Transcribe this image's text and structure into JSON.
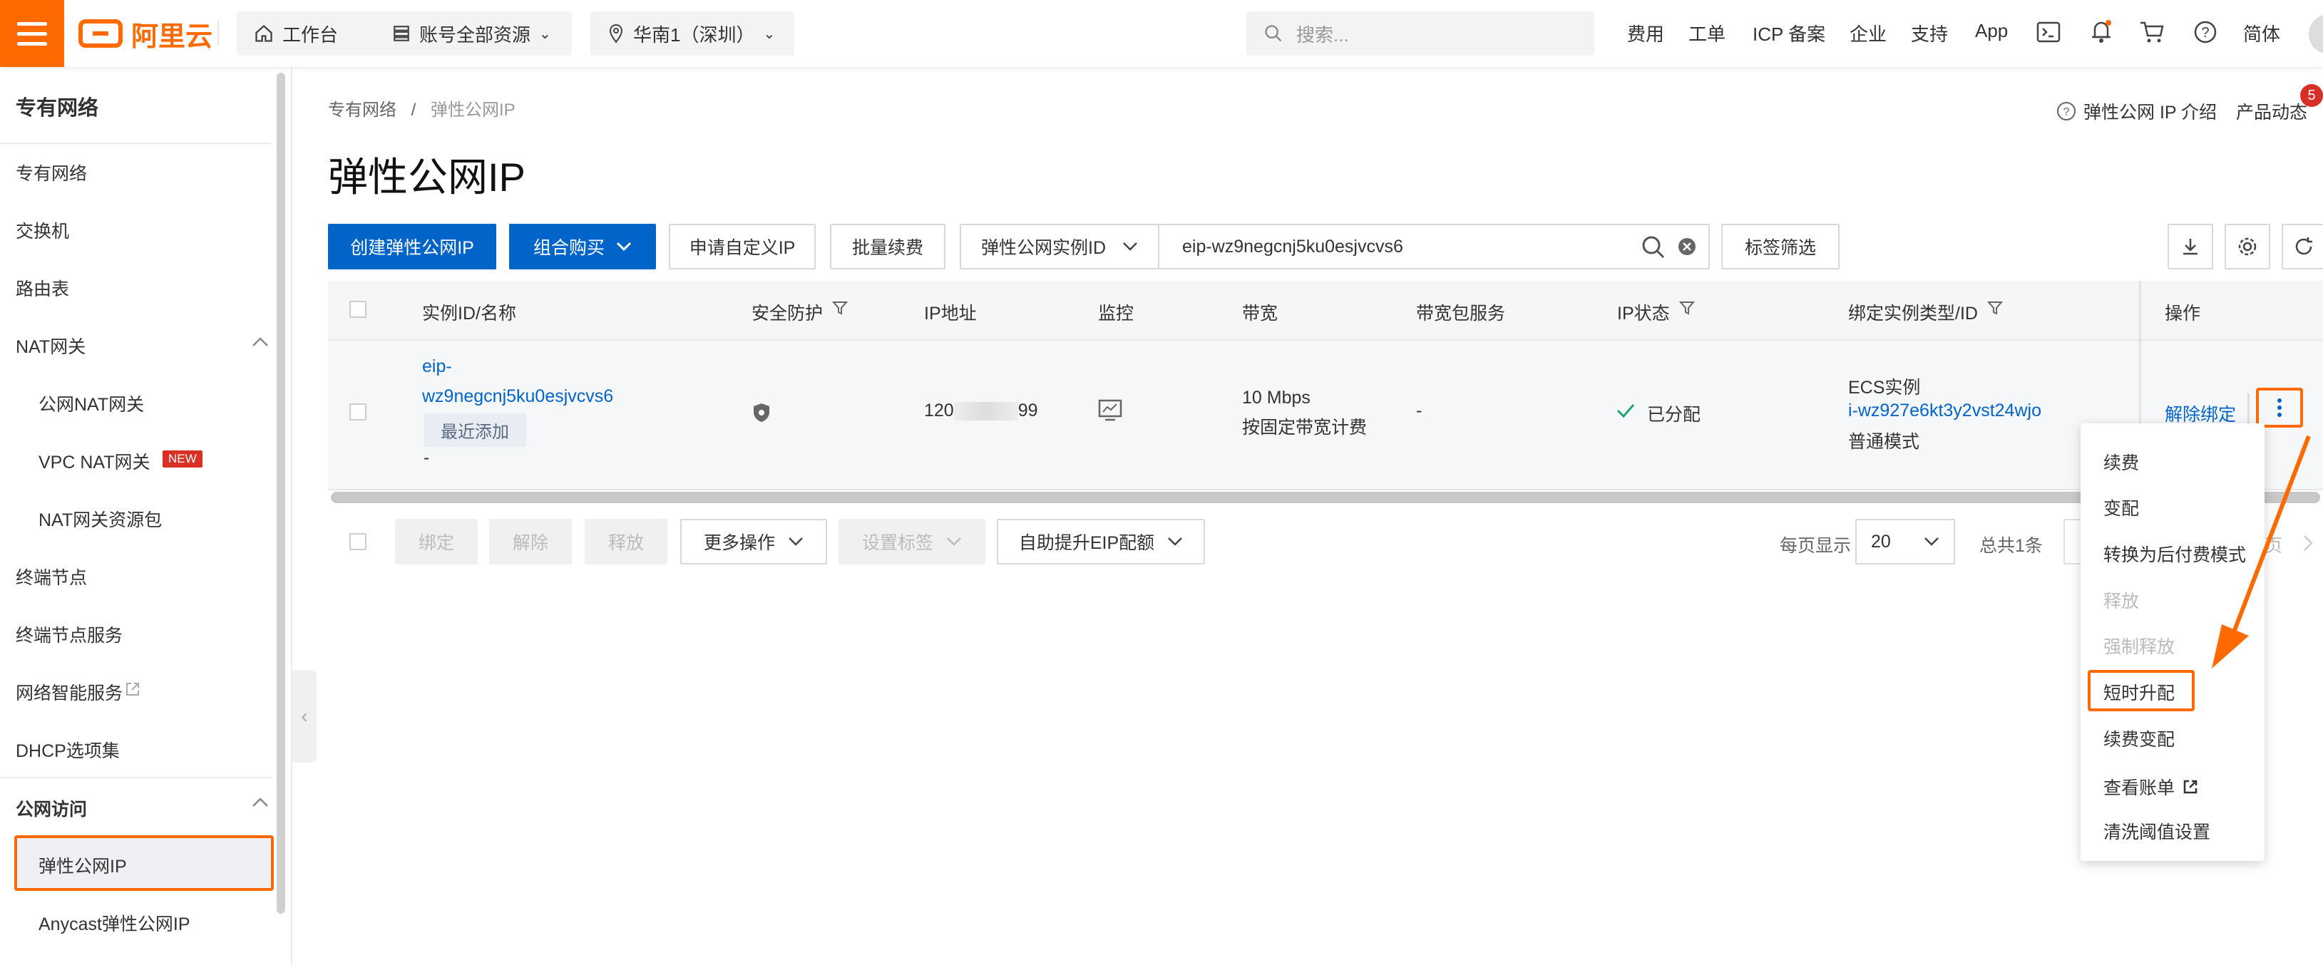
{
  "topbar": {
    "logo": "阿里云",
    "workbench": "工作台",
    "resources": "账号全部资源",
    "region": "华南1（深圳）",
    "search_placeholder": "搜索...",
    "links": [
      "费用",
      "工单",
      "ICP 备案",
      "企业",
      "支持",
      "App",
      "简体"
    ]
  },
  "sidebar": {
    "title": "专有网络",
    "items": [
      {
        "label": "专有网络"
      },
      {
        "label": "交换机"
      },
      {
        "label": "路由表"
      },
      {
        "label": "NAT网关"
      },
      {
        "label": "公网NAT网关"
      },
      {
        "label": "VPC NAT网关",
        "badge": "NEW"
      },
      {
        "label": "NAT网关资源包"
      },
      {
        "label": "终端节点"
      },
      {
        "label": "终端节点服务"
      },
      {
        "label": "网络智能服务"
      },
      {
        "label": "DHCP选项集"
      },
      {
        "label": "公网访问"
      },
      {
        "label": "弹性公网IP"
      },
      {
        "label": "Anycast弹性公网IP"
      }
    ]
  },
  "header": {
    "breadcrumb": [
      "专有网络",
      "/",
      "弹性公网IP"
    ],
    "title": "弹性公网IP",
    "intro_link": "弹性公网 IP 介绍",
    "news_link": "产品动态",
    "news_count": "5"
  },
  "toolbar": {
    "create": "创建弹性公网IP",
    "combo_buy": "组合购买",
    "apply_custom": "申请自定义IP",
    "batch_renew": "批量续费",
    "filter_field": "弹性公网实例ID",
    "search_value": "eip-wz9negcnj5ku0esjvcvs6",
    "tag_filter": "标签筛选"
  },
  "table": {
    "columns": [
      "实例ID/名称",
      "安全防护",
      "IP地址",
      "监控",
      "带宽",
      "带宽包服务",
      "IP状态",
      "绑定实例类型/ID",
      "操作"
    ],
    "rows": [
      {
        "id_line1": "eip-",
        "id_line2": "wz9negcnj5ku0esjvcvs6",
        "tag": "最近添加",
        "name": "-",
        "ip_prefix": "120",
        "ip_suffix": "99",
        "bandwidth": "10 Mbps",
        "billing": "按固定带宽计费",
        "bandwidth_pkg": "-",
        "status": "已分配",
        "bind_type": "ECS实例",
        "bind_id": "i-wz927e6kt3y2vst24wjo",
        "bind_mode": "普通模式",
        "action": "解除绑定"
      }
    ]
  },
  "footer": {
    "bind": "绑定",
    "unbind": "解除",
    "release": "释放",
    "more_ops": "更多操作",
    "set_tags": "设置标签",
    "raise_quota": "自助提升EIP配额",
    "per_page_label": "每页显示",
    "per_page": "20",
    "total": "总共1条",
    "page_suffix": "页"
  },
  "dropdown": {
    "items": [
      {
        "label": "续费",
        "disabled": false
      },
      {
        "label": "变配",
        "disabled": false
      },
      {
        "label": "转换为后付费模式",
        "disabled": false
      },
      {
        "label": "释放",
        "disabled": true
      },
      {
        "label": "强制释放",
        "disabled": true
      },
      {
        "label": "短时升配",
        "disabled": false
      },
      {
        "label": "续费变配",
        "disabled": false
      },
      {
        "label": "查看账单",
        "disabled": false
      },
      {
        "label": "清洗阈值设置",
        "disabled": false
      }
    ]
  },
  "colors": {
    "brand": "#ff6a00",
    "primary": "#0064c8",
    "success": "#1ea672"
  }
}
